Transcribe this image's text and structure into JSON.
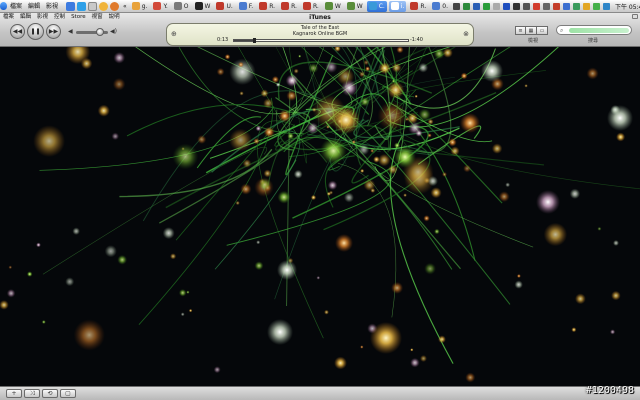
{
  "menubar": {
    "menus": [
      "檔案",
      "編輯",
      "影視",
      "控制",
      "Store",
      "視窗",
      "說明"
    ],
    "tasks": [
      {
        "label": "g.",
        "color": "#e8a23a"
      },
      {
        "label": "Y.",
        "color": "#d24a3a"
      },
      {
        "label": "O",
        "color": "#7a7a7a"
      },
      {
        "label": "W",
        "color": "#222222"
      },
      {
        "label": "U.",
        "color": "#c0392b"
      },
      {
        "label": "F.",
        "color": "#4a7bd0"
      },
      {
        "label": "R.",
        "color": "#c0392b"
      },
      {
        "label": "R.",
        "color": "#c0392b"
      },
      {
        "label": "R.",
        "color": "#c0392b"
      },
      {
        "label": "W",
        "color": "#5a8d3a"
      },
      {
        "label": "W",
        "color": "#5a8d3a"
      },
      {
        "label": "C.",
        "color": "#3a9ad9",
        "state": "active"
      },
      {
        "label": "i.",
        "color": "#ffffff",
        "state": "active2"
      },
      {
        "label": "R.",
        "color": "#c0392b"
      },
      {
        "label": "0.",
        "color": "#4a7bd0"
      }
    ],
    "clock": "下午 05:49"
  },
  "itunes": {
    "menu": [
      "檔案",
      "編輯",
      "影視",
      "控制",
      "Store",
      "視窗",
      "說明"
    ],
    "window_title": "iTunes",
    "now_playing": {
      "song": "Tale of the East",
      "artist": "Kagnarok Online BGM",
      "elapsed": "0:13",
      "remaining": "-1:40",
      "progress": 0.115
    },
    "volume": 0.75,
    "view_label": "檢視",
    "search_label": "搜尋"
  },
  "bottom_bar": {
    "buttons": [
      "+",
      "⤨",
      "⟲",
      "▢"
    ]
  },
  "watermark": "#1200498"
}
